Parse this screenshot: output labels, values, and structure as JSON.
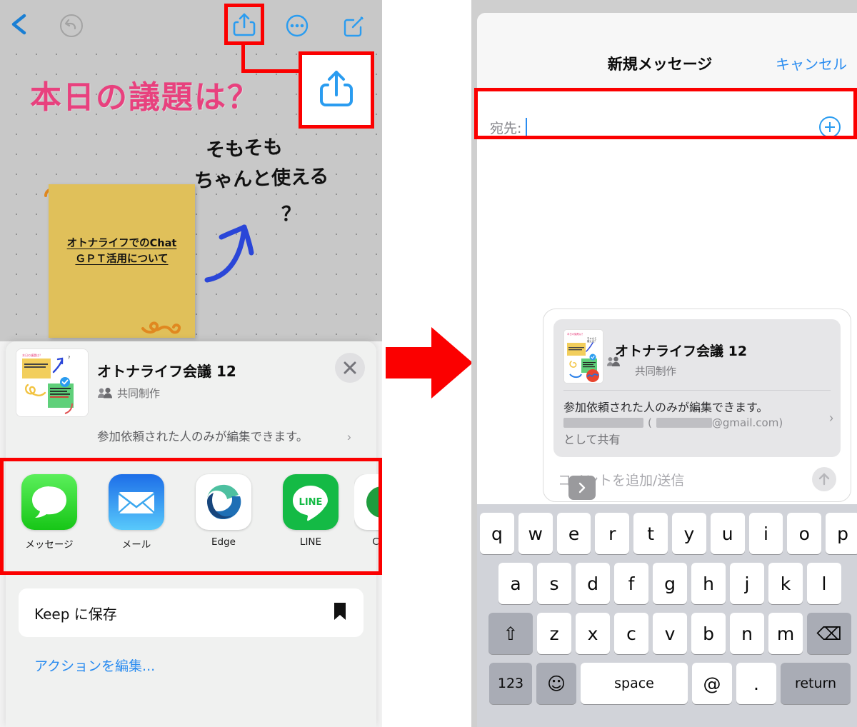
{
  "left": {
    "toolbar": {
      "back_icon": "chevron-left-icon",
      "undo_icon": "undo-icon",
      "share_icon": "share-up-icon",
      "more_icon": "ellipsis-circle-icon",
      "edit_icon": "compose-icon"
    },
    "canvas": {
      "title": "本日の議題は？",
      "sticky_text_line1": "オトナライフでのChat",
      "sticky_text_line2": "ＧＰＴ活用について",
      "handwriting_line1": "そもそも",
      "handwriting_line2": "ちゃんと使える",
      "handwriting_line3": "？"
    },
    "callout": {
      "icon": "share-up-icon",
      "accent_color": "#fb0000",
      "icon_color": "#2a9cf0"
    },
    "share_sheet": {
      "title": "オトナライフ会議 12",
      "subtitle": "共同制作",
      "subtitle_icon": "people-icon",
      "close_icon": "close-x-icon",
      "permission": "参加依頼された人のみが編集できます。",
      "permission_chevron": "›",
      "apps": [
        {
          "label": "メッセージ",
          "icon": "messages-app-icon"
        },
        {
          "label": "メール",
          "icon": "mail-app-icon"
        },
        {
          "label": "Edge",
          "icon": "edge-app-icon"
        },
        {
          "label": "LINE",
          "icon": "line-app-icon"
        },
        {
          "label": "C",
          "icon": "partial-app-icon"
        }
      ],
      "action_label": "Keep に保存",
      "action_icon": "bookmark-icon",
      "edit_actions_label": "アクションを編集..."
    }
  },
  "flow_arrow": {
    "icon": "right-arrow-icon",
    "color": "#fb0000"
  },
  "right": {
    "nav": {
      "title": "新規メッセージ",
      "cancel_label": "キャンセル"
    },
    "to_field": {
      "label": "宛先:",
      "value": "",
      "add_icon": "plus-circle-icon"
    },
    "bubble": {
      "title": "オトナライフ会議 12",
      "subtitle": "共同制作",
      "subtitle_icon": "people-icon",
      "close_icon": "close-x-icon",
      "permission": "参加依頼された人のみが編集できます。",
      "email_open_paren": "(",
      "email_domain": "@gmail.com)",
      "email_close": "",
      "share_as": "として共有",
      "chevron": "›",
      "comment_placeholder": "コメントを追加/送信",
      "send_icon": "send-up-arrow-icon",
      "expand_icon": "chevron-right-icon"
    },
    "keyboard": {
      "row1": [
        "q",
        "w",
        "e",
        "r",
        "t",
        "y",
        "u",
        "i",
        "o",
        "p"
      ],
      "row2": [
        "a",
        "s",
        "d",
        "f",
        "g",
        "h",
        "j",
        "k",
        "l"
      ],
      "row3_shift": "⇧",
      "row3": [
        "z",
        "x",
        "c",
        "v",
        "b",
        "n",
        "m"
      ],
      "row3_delete": "⌫",
      "row4_numbers": "123",
      "row4_emoji": "☺",
      "row4_space": "space",
      "row4_at": "@",
      "row4_period": ".",
      "row4_return": "return"
    }
  }
}
